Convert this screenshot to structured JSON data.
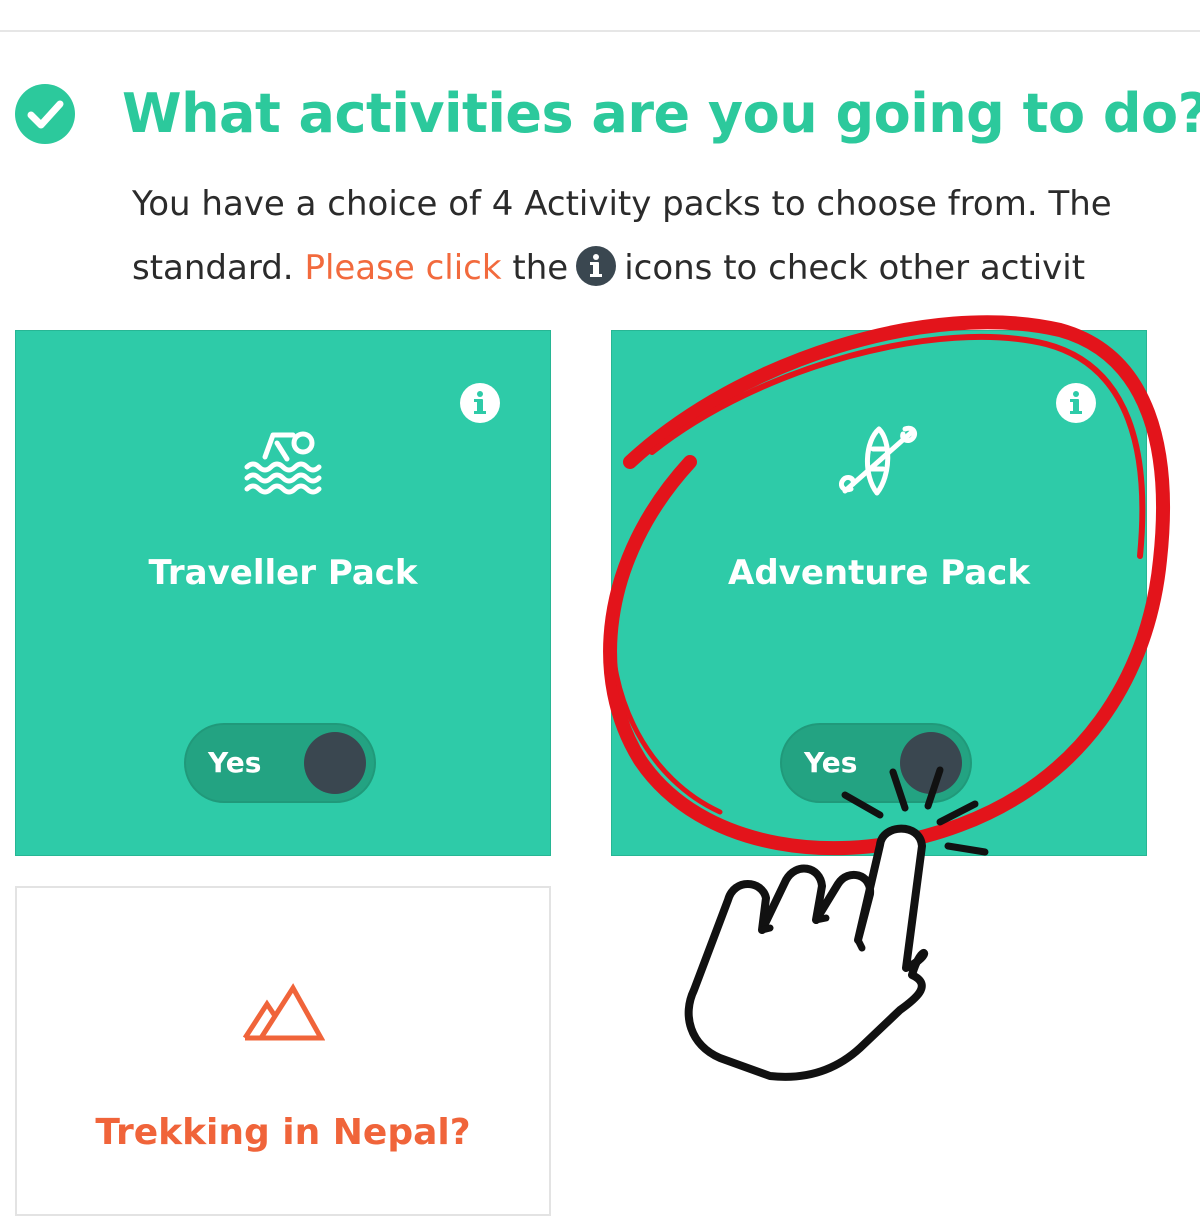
{
  "section": {
    "title": "What activities are you going to do?",
    "intro_line1": "You have a choice of 4 Activity packs to choose from. The",
    "intro_line2_prefix": "standard.",
    "intro_link": "Please click",
    "intro_line2_mid": "the",
    "intro_line2_suffix": "icons to check other activit"
  },
  "packs": [
    {
      "title": "Traveller Pack",
      "icon": "swimmer-icon",
      "toggle_label": "Yes",
      "selected": true
    },
    {
      "title": "Adventure Pack",
      "icon": "kayak-paddle-icon",
      "toggle_label": "Yes",
      "selected": true
    },
    {
      "title": "Trekking in Nepal?",
      "icon": "mountain-icon",
      "selected": false
    }
  ],
  "colors": {
    "accent": "#2cc99c",
    "card_active": "#2ecba8",
    "toggle_track": "#23a382",
    "toggle_knob": "#3a4750",
    "highlight": "#f26a3d",
    "annotation_red": "#e3141b"
  }
}
